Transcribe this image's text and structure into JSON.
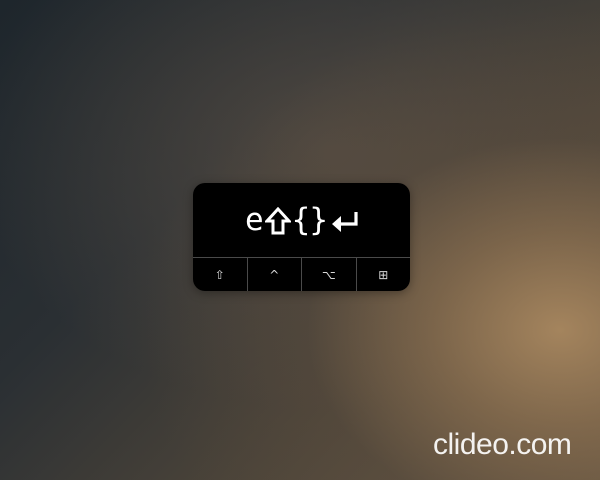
{
  "key_display": {
    "pressed_keys": {
      "letter": "e",
      "shift_icon": "shift-arrow-icon",
      "braces": "{}",
      "enter_icon": "return-arrow-icon"
    },
    "modifiers": [
      {
        "name": "shift",
        "label": "⇧",
        "icon": "shift-icon"
      },
      {
        "name": "control",
        "label": "^",
        "icon": "control-icon"
      },
      {
        "name": "option",
        "label": "⌥",
        "icon": "option-icon"
      },
      {
        "name": "command",
        "label": "⊞",
        "icon": "windows-icon"
      }
    ]
  },
  "watermark": {
    "text": "clideo.com"
  }
}
